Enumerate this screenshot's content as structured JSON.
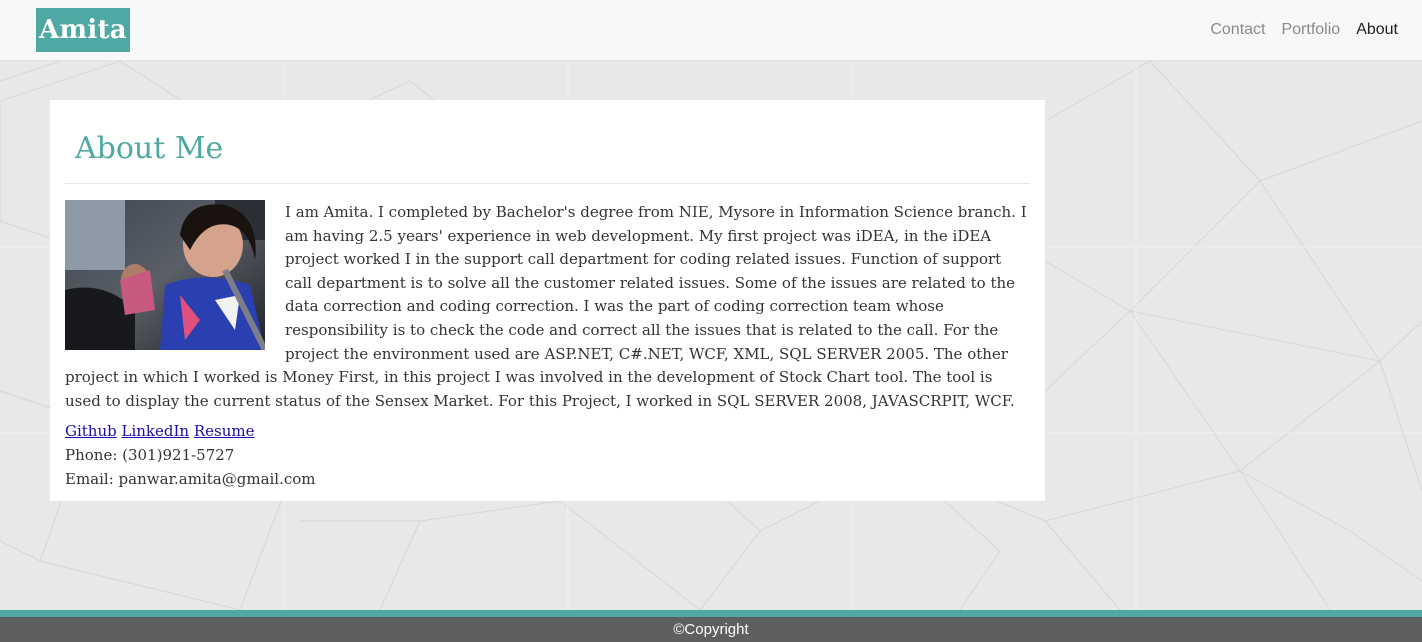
{
  "nav": {
    "brand": "Amita",
    "links": [
      {
        "label": "Contact"
      },
      {
        "label": "Portfolio"
      },
      {
        "label": "About",
        "active": true
      }
    ]
  },
  "main": {
    "heading": "About Me",
    "photo_alt": "Photo of Amita",
    "bio": "I am Amita. I completed by Bachelor's degree from NIE, Mysore in Information Science branch. I am having 2.5 years' experience in web development. My first project was iDEA, in the iDEA project worked I in the support call department for coding related issues. Function of support call department is to solve all the customer related issues. Some of the issues are related to the data correction and coding correction. I was the part of coding correction team whose responsibility is to check the code and correct all the issues that is related to the call. For the project the environment used are ASP.NET, C#.NET, WCF, XML, SQL SERVER 2005. The other project in which I worked is Money First, in this project I was involved in the development of Stock Chart tool. The tool is used to display the current status of the Sensex Market. For this Project, I worked in SQL SERVER 2008, JAVASCRPIT, WCF.",
    "links": {
      "github": "Github",
      "linkedin": "LinkedIn",
      "resume": "Resume"
    },
    "phone": "Phone: (301)921-5727",
    "email": "Email: panwar.amita@gmail.com"
  },
  "footer": {
    "copyright": "©Copyright"
  },
  "colors": {
    "accent": "#4fa9a2",
    "footer_bg": "#5f5f5f",
    "page_bg": "#e8e8e8",
    "link": "#1a0dab"
  }
}
